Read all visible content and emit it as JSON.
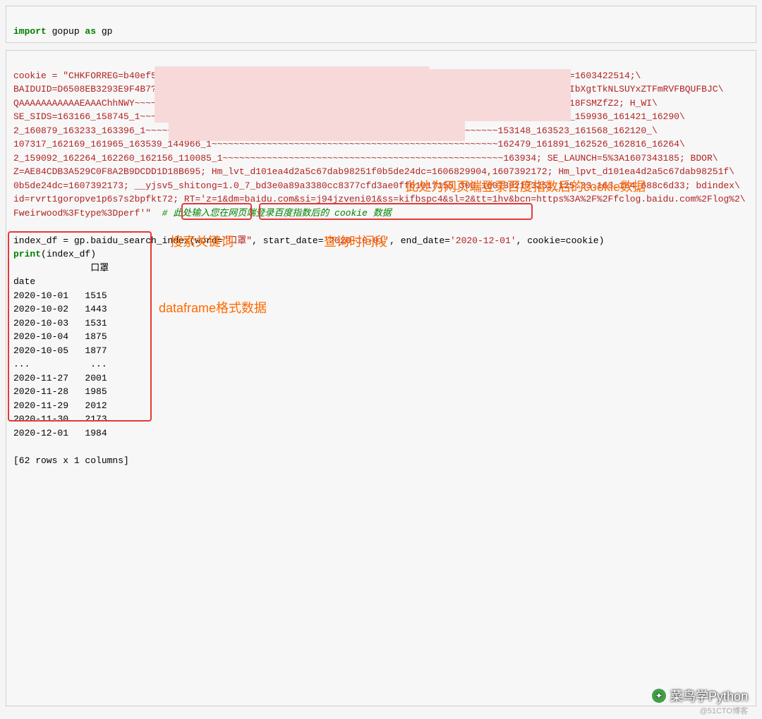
{
  "block1": {
    "line1_kw_import": "import",
    "line1_mod": " gopup ",
    "line1_kw_as": "as",
    "line1_alias": " gp"
  },
  "block2": {
    "cookie_lines": "cookie = \"CHKFORREG=b40ef5b757299ebd04c18f17610a9011; BIDUPSID=D6508EB3293E9F4BAA749ED6B6F504E4; PSTM=1603422514;\\\nBAIDUID=D6508EB3293E9F4B7?~~~~~~~~~~~~~~~~~~~~~~~~~~~~~~~~~~~~~~~~~~~~~~2eVISbVWJQ1A1CV1HVQM1Tc11adzJIbXgtTkNLSUYxZTFmRVFBQUFBJC\\\nQAAAAAAAAAAAEAAAChhNWY~~~~~~~~~~~~~~~~~~~~~~~~~~~~~~~~~~~~~~~~~~~~~~~~~~~~~~~~~~~~~~~~~AAAAAAAAAAAVIx18FSMZfZ2; H_WI\\\nSE_SIDS=163166_158745_1~~~~~~~~~~~~~~~~~~~~~~~~~~~~~~~~~~~~~~~~~~~~~~~~~~~~~~~~~~~~~~~~~162372_159382_159936_161421_16290\\\n2_160879_163233_163396_1~~~~~~~~~~~~~~~~~~~~~~~~~~~~~~~~~~~~~~~~~~~~~~~~~~~~~~~~~~~~~~~~153148_163523_161568_162120_\\\n107317_162169_161965_163539_144966_1~~~~~~~~~~~~~~~~~~~~~~~~~~~~~~~~~~~~~~~~~~~~~~~~~~~~162479_161891_162526_162816_16264\\\n2_159092_162264_162260_162156_110085_1~~~~~~~~~~~~~~~~~~~~~~~~~~~~~~~~~~~~~~~~~~~~~~~~~~~163934; SE_LAUNCH=5%3A1607343185; BDOR\\\nZ=AE84CDB3A529C0F8A2B9DCDD1D18B695; Hm_lvt_d101ea4d2a5c67dab98251f0b5de24dc=1606829904,1607392172; Hm_lpvt_d101ea4d2a5c67dab98251f\\\n0b5de24dc=1607392173; __yjsv5_shitong=1.0_7_bd3e0a89a3380cc8377cfd3ae0ff61017155_300_1607392173251_125.33.163.164_688c6d33; bdindex\\\nid=rvrt1goropve1p6s7s2bpfkt72; RT='z=1&dm=baidu.com&si=j94jzveni01&ss=kifbspc4&sl=2&tt=1hv&bcn=https%3A%2F%2Ffclog.baidu.com%2Flog%2\\\nFweirwood%3Ftype%3Dperf'\"",
    "comment": "  # 此处输入您在网页端登录百度指数后的 cookie 数据",
    "call_left": "index_df = gp.baidu_search_index(",
    "call_word_key": "word=",
    "call_word_val": "\"口罩\"",
    "call_sep1": ", ",
    "call_start_key": "start_date=",
    "call_start_val": "'2020-10-01'",
    "call_sep2": ", ",
    "call_end_key": "end_date=",
    "call_end_val": "'2020-12-01'",
    "call_sep3": ", cookie=cookie)",
    "print_kw": "print",
    "print_arg": "(index_df)",
    "output": "              口罩\ndate\n2020-10-01   1515\n2020-10-02   1443\n2020-10-03   1531\n2020-10-04   1875\n2020-10-05   1877\n...           ...\n2020-11-27   2001\n2020-11-28   1985\n2020-11-29   2012\n2020-11-30   2173\n2020-12-01   1984\n\n[62 rows x 1 columns]"
  },
  "annotations": {
    "a1": "此处为网页端登录百度指数后的cookie数据",
    "a2": "搜索关键词",
    "a3": "查询时间段",
    "a4": "dataframe格式数据"
  },
  "watermark": {
    "main": "菜鸟学Python",
    "sub": "@51CTO博客"
  }
}
